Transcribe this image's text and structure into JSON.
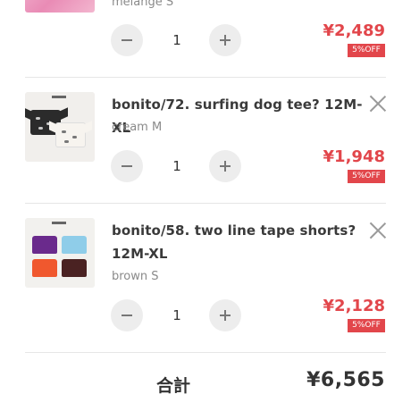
{
  "items": [
    {
      "variant": "melange S",
      "quantity": "1",
      "price": "¥2,489",
      "badge": "5%OFF"
    },
    {
      "title": "bonito/72. surfing dog tee? 12M-XL",
      "variant": "cream M",
      "quantity": "1",
      "price": "¥1,948",
      "badge": "5%OFF"
    },
    {
      "title": "bonito/58. two line tape shorts? 12M-XL",
      "variant": "brown S",
      "quantity": "1",
      "price": "¥2,128",
      "badge": "5%OFF"
    }
  ],
  "summary": {
    "total_label": "合計",
    "total_value": "¥6,565"
  },
  "colors": {
    "accent_price": "#e2464b",
    "qty_button_bg": "#ededed",
    "text": "#333333"
  }
}
